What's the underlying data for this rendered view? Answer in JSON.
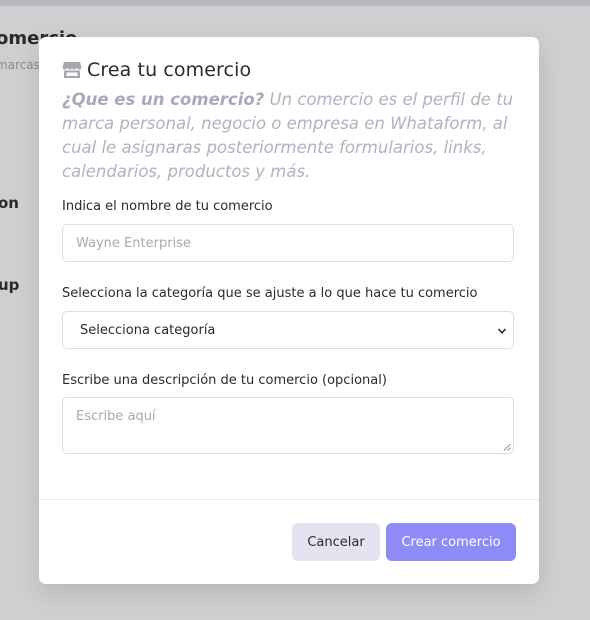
{
  "background": {
    "title_fragment": "omercio",
    "subtitle_fragment": "marcas",
    "item1_fragment": "on",
    "item2_fragment": "up"
  },
  "modal": {
    "title": "Crea tu comercio",
    "icon": "store-icon",
    "intro_question": "¿Que es un comercio?",
    "intro_text": " Un comercio es el perfil de tu marca personal, negocio o empresa en Whataform, al cual le asignaras posteriormente formularios, links, calendarios, productos y más.",
    "name_label": "Indica el nombre de tu comercio",
    "name_placeholder": "Wayne Enterprise",
    "category_label": "Selecciona la categoría que se ajuste a lo que hace tu comercio",
    "category_selected": "Selecciona categoría",
    "description_label": "Escribe una descripción de tu comercio (opcional)",
    "description_placeholder": "Escribe aquí",
    "cancel_label": "Cancelar",
    "create_label": "Crear comercio"
  },
  "colors": {
    "accent": "#8e8bf7",
    "cancel_bg": "#e4e3ef",
    "intro_text": "#b2b1c2",
    "backdrop": "#cfcfd1"
  }
}
